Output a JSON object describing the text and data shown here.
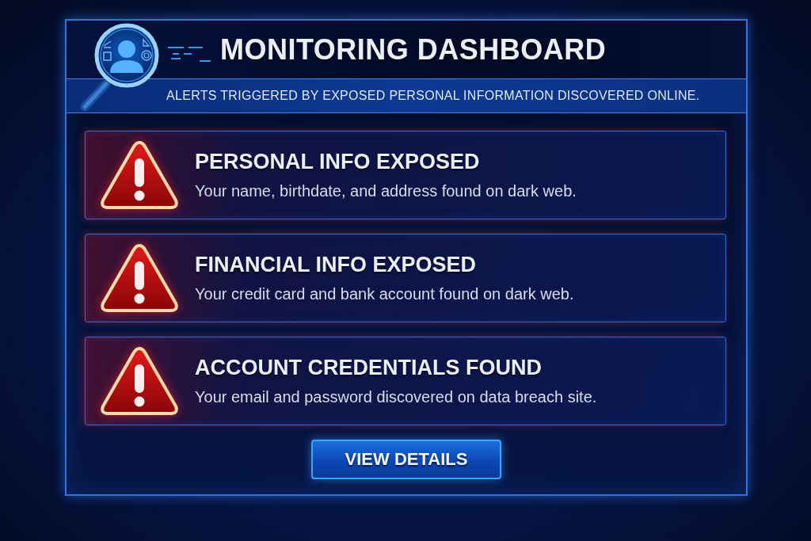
{
  "header": {
    "title": "MONITORING DASHBOARD",
    "subtitle": "ALERTS TRIGGERED BY EXPOSED PERSONAL INFORMATION DISCOVERED ONLINE."
  },
  "alerts": [
    {
      "title": "PERSONAL INFO EXPOSED",
      "description": "Your name, birthdate, and address found on dark web."
    },
    {
      "title": "FINANCIAL INFO EXPOSED",
      "description": "Your credit card and bank account found on dark web."
    },
    {
      "title": "ACCOUNT CREDENTIALS FOUND",
      "description": "Your email and password discovered on data breach site."
    }
  ],
  "button": {
    "label": "VIEW DETAILS"
  }
}
